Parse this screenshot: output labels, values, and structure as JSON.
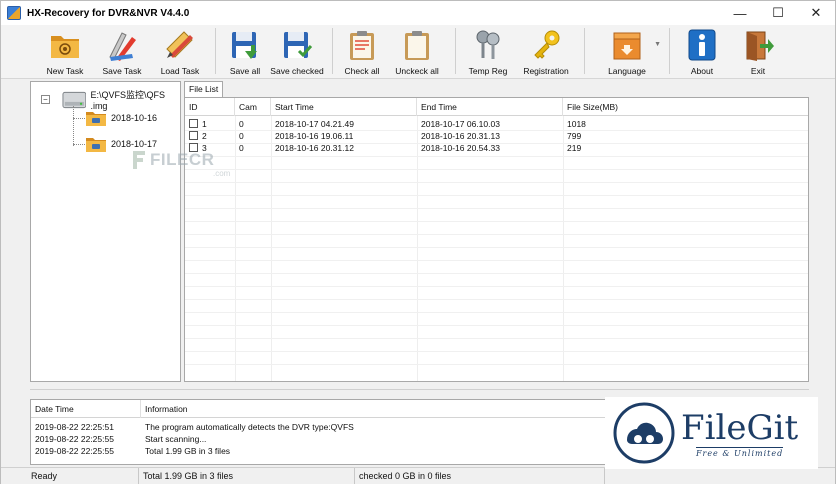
{
  "window": {
    "title": "HX-Recovery for DVR&NVR  V4.4.0",
    "controls": {
      "minimize": "—",
      "maximize": "☐",
      "close": "✕"
    }
  },
  "toolbar": {
    "new_task": "New Task",
    "save_task": "Save Task",
    "load_task": "Load Task",
    "save_all": "Save all",
    "save_checked": "Save checked",
    "check_all": "Check all",
    "uncheck_all": "Unckeck all",
    "temp_reg": "Temp Reg",
    "registration": "Registration",
    "language": "Language",
    "about": "About",
    "exit": "Exit"
  },
  "tree": {
    "root_label": "E:\\QVFS监控\\QFS .img",
    "expander": "−",
    "children": [
      "2018-10-16",
      "2018-10-17"
    ]
  },
  "file_list": {
    "tab_label": "File List",
    "columns": [
      "ID",
      "Cam",
      "Start Time",
      "End Time",
      "File Size(MB)"
    ],
    "rows": [
      {
        "id": "1",
        "cam": "0",
        "start": "2018-10-17 04.21.49",
        "end": "2018-10-17 06.10.03",
        "size": "1018"
      },
      {
        "id": "2",
        "cam": "0",
        "start": "2018-10-16 19.06.11",
        "end": "2018-10-16 20.31.13",
        "size": "799"
      },
      {
        "id": "3",
        "cam": "0",
        "start": "2018-10-16 20.31.12",
        "end": "2018-10-16 20.54.33",
        "size": "219"
      }
    ]
  },
  "log": {
    "columns": [
      "Date Time",
      "Information"
    ],
    "rows": [
      {
        "time": "2019-08-22 22:25:51",
        "info": "The program automatically detects the DVR type:QVFS"
      },
      {
        "time": "2019-08-22 22:25:55",
        "info": "Start scanning..."
      },
      {
        "time": "2019-08-22 22:25:55",
        "info": "Total 1.99 GB in 3 files"
      }
    ]
  },
  "statusbar": {
    "state": "Ready",
    "total": "Total 1.99 GB in 3 files",
    "checked": "checked 0 GB in 0 files"
  },
  "watermarks": {
    "filecr": "FILECR",
    "filecr_sub": ".com",
    "filegit_name": "FileGit",
    "filegit_tag": "Free & Unlimited"
  },
  "colors": {
    "folder": "#e9a52b",
    "save_green": "#3f9b3b",
    "save_blue": "#2e66b5",
    "filegit_navy": "#1d3d66"
  }
}
